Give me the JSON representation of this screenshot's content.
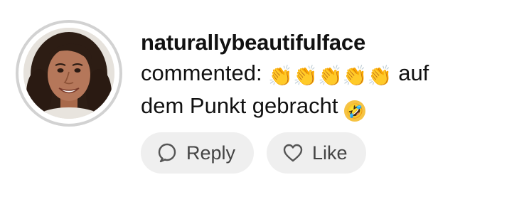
{
  "comment": {
    "username": "naturallybeautifulface",
    "prefix": "commented:",
    "emojis": [
      "👏",
      "👏",
      "👏",
      "👏",
      "👏"
    ],
    "text_line1_suffix": "auf",
    "text_line2": "dem Punkt gebracht",
    "end_emoji": "🤣"
  },
  "actions": {
    "reply_label": "Reply",
    "like_label": "Like"
  },
  "icons": {
    "reply": "speech-bubble-icon",
    "like": "heart-icon"
  },
  "colors": {
    "ring": "#d2d2d2",
    "pill_bg": "#efefef",
    "text": "#111111",
    "pill_text": "#444444"
  }
}
